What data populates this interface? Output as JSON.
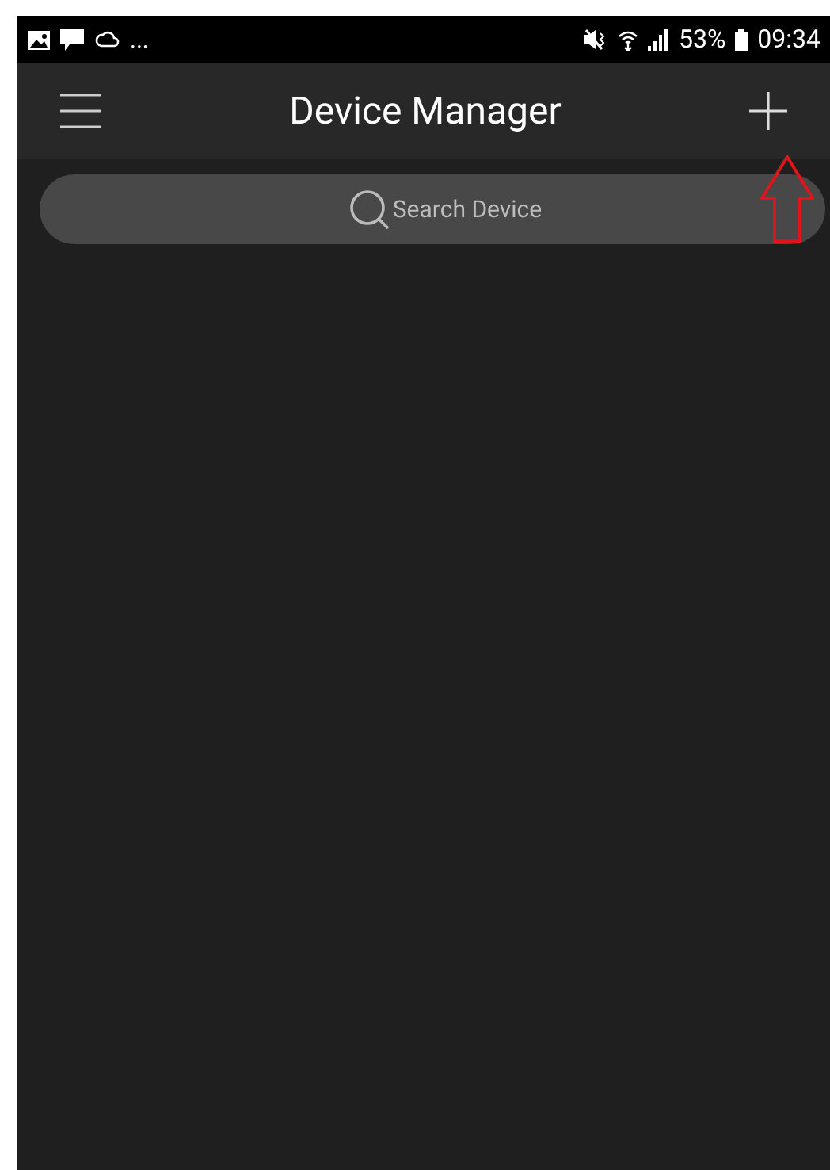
{
  "status_bar": {
    "overflow": "...",
    "battery": "53%",
    "time": "09:34"
  },
  "app_bar": {
    "title": "Device Manager"
  },
  "search": {
    "placeholder": "Search Device"
  }
}
